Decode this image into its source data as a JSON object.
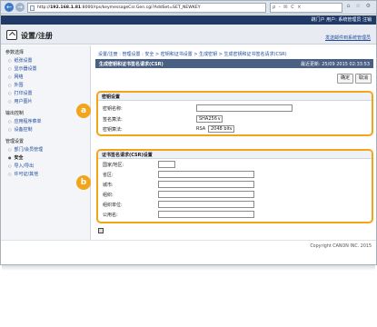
{
  "browser": {
    "url_prefix": "http://",
    "url_host": "192.168.1.81",
    "url_rest": ":8000/rps/keymessageCsr.Gen.cgi?AddSet=SET_NEWKEY",
    "tab_tools": "ρ - ☒ C ×",
    "right_icons": "⌂ ☆ ⚙"
  },
  "topbar": {
    "links": "跳门户   用户: 系统管理员  注销"
  },
  "header": {
    "title": "设置/注册",
    "right_link": "发送邮件到系统管理员"
  },
  "sidebar": {
    "sections": [
      {
        "label": "参数选择",
        "items": [
          {
            "label": "纸张设置"
          },
          {
            "label": "显示器设置"
          },
          {
            "label": "网络"
          },
          {
            "label": "外围"
          },
          {
            "label": "打印设置"
          },
          {
            "label": "用户图片"
          }
        ]
      },
      {
        "label": "输出控制",
        "items": [
          {
            "label": "应用程序菜单"
          },
          {
            "label": "设备控制"
          }
        ]
      },
      {
        "label": "管理设置",
        "items": [
          {
            "label": "部门/会员管理"
          },
          {
            "label": "安全"
          },
          {
            "label": "导入/导出"
          },
          {
            "label": "许可证/其他"
          }
        ]
      }
    ]
  },
  "main": {
    "breadcrumb": "设置/注册 : 管理设置 : 安全 > 密钥和证书设置 > 生成密钥 > 生成密钥和证书签名请求(CSR)",
    "page_title": "生成密钥和证书签名请求(CSR)",
    "last_update": "最近更新: 25/09 2015 02:33:53",
    "ok_label": "确定",
    "cancel_label": "取消",
    "key_section": {
      "title": "密钥设置",
      "rows": [
        {
          "label": "密钥名称:",
          "value": ""
        },
        {
          "label": "签名算法:",
          "value": "SHA256"
        },
        {
          "label": "密钥算法:",
          "prefix": "RSA",
          "value": "2048 bit"
        }
      ]
    },
    "csr_section": {
      "title": "证书签名请求(CSR)设置",
      "rows": [
        {
          "label": "国家/地区:",
          "value": ""
        },
        {
          "label": "省区:",
          "value": ""
        },
        {
          "label": "城市:",
          "value": ""
        },
        {
          "label": "组织:",
          "value": ""
        },
        {
          "label": "组织单位:",
          "value": ""
        },
        {
          "label": "公用名:",
          "value": ""
        }
      ]
    },
    "markers": {
      "a": "a",
      "b": "b"
    }
  },
  "footer": {
    "copyright": "Copyright CANON INC. 2015"
  }
}
